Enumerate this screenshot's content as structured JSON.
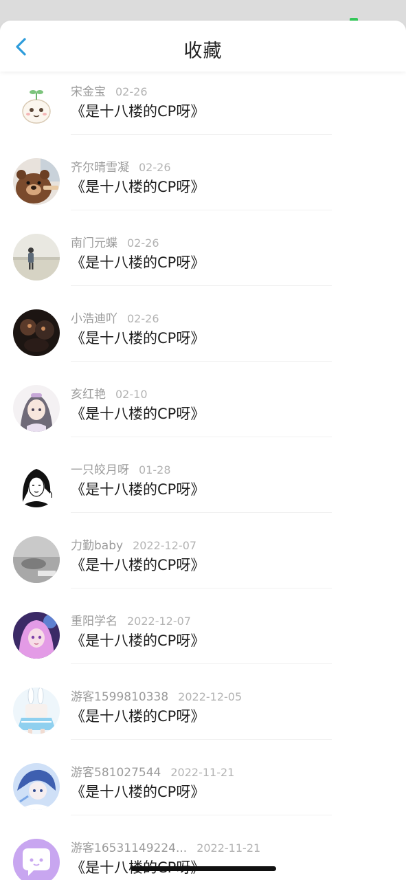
{
  "header": {
    "title": "收藏",
    "back_icon": "chevron-left-icon",
    "accent": "#2d9cdb"
  },
  "items": [
    {
      "name": "宋金宝",
      "date": "02-26",
      "title": "《是十八楼的CP呀》",
      "avatar": "cartoon-sprout-avatar"
    },
    {
      "name": "齐尔晴雪凝",
      "date": "02-26",
      "title": "《是十八楼的CP呀》",
      "avatar": "bear-avatar"
    },
    {
      "name": "南门元蝶",
      "date": "02-26",
      "title": "《是十八楼的CP呀》",
      "avatar": "beach-person-avatar"
    },
    {
      "name": "小浩迪吖",
      "date": "02-26",
      "title": "《是十八楼的CP呀》",
      "avatar": "dark-figure-avatar"
    },
    {
      "name": "亥红艳",
      "date": "02-10",
      "title": "《是十八楼的CP呀》",
      "avatar": "anime-girl-avatar"
    },
    {
      "name": "一只皎月呀",
      "date": "01-28",
      "title": "《是十八楼的CP呀》",
      "avatar": "line-art-girl-avatar"
    },
    {
      "name": "力勤baby",
      "date": "2022-12-07",
      "title": "《是十八楼的CP呀》",
      "avatar": "gray-photo-avatar"
    },
    {
      "name": "重阳学名",
      "date": "2022-12-07",
      "title": "《是十八楼的CP呀》",
      "avatar": "pink-hair-girl-avatar"
    },
    {
      "name": "游客1599810338",
      "date": "2022-12-05",
      "title": "《是十八楼的CP呀》",
      "avatar": "bunny-anime-avatar"
    },
    {
      "name": "游客581027544",
      "date": "2022-11-21",
      "title": "《是十八楼的CP呀》",
      "avatar": "blue-anime-avatar"
    },
    {
      "name": "游客16531149224...",
      "date": "2022-11-21",
      "title": "《是十八楼的CP呀》",
      "avatar": "chat-bubble-avatar"
    }
  ]
}
